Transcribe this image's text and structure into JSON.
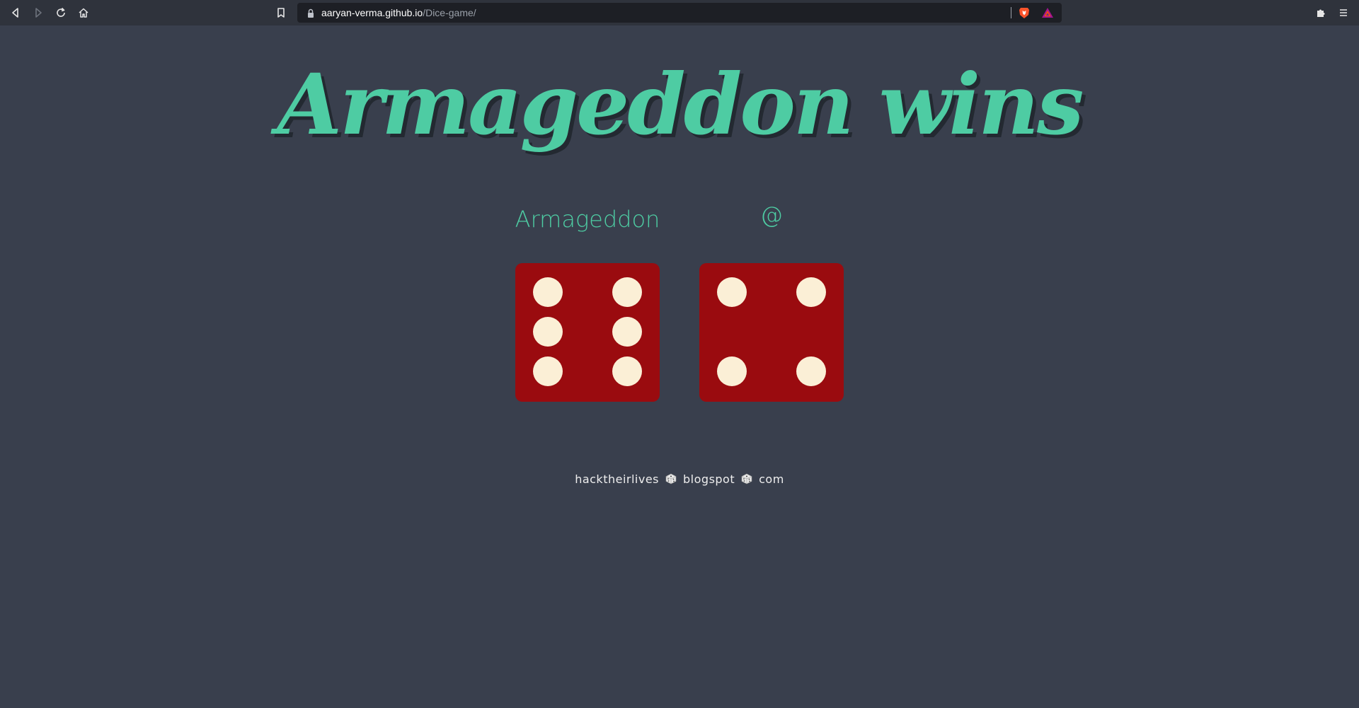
{
  "browser": {
    "url_host": "aaryan-verma.github.io",
    "url_path": "/Dice-game/",
    "icons": {
      "back": "back-arrow-icon",
      "forward": "forward-arrow-icon",
      "reload": "reload-icon",
      "home": "home-icon",
      "bookmark": "bookmark-icon",
      "lock": "lock-icon",
      "brave_shields": "brave-shield-icon",
      "rewards": "brave-rewards-icon",
      "extensions": "puzzle-icon",
      "menu": "hamburger-menu-icon"
    }
  },
  "page": {
    "title": "Armageddon wins",
    "player1_name": "Armageddon",
    "player2_name": "@",
    "player1_dice_value": 6,
    "player2_dice_value": 4,
    "footer": {
      "part1": "hacktheirlives",
      "part2": "blogspot",
      "part3": "com",
      "separator_icon": "dice-icon"
    },
    "colors": {
      "background": "#393f4d",
      "accent": "#4ecca3",
      "dice": "#9a0b0f",
      "pip": "#fbefd6"
    }
  }
}
